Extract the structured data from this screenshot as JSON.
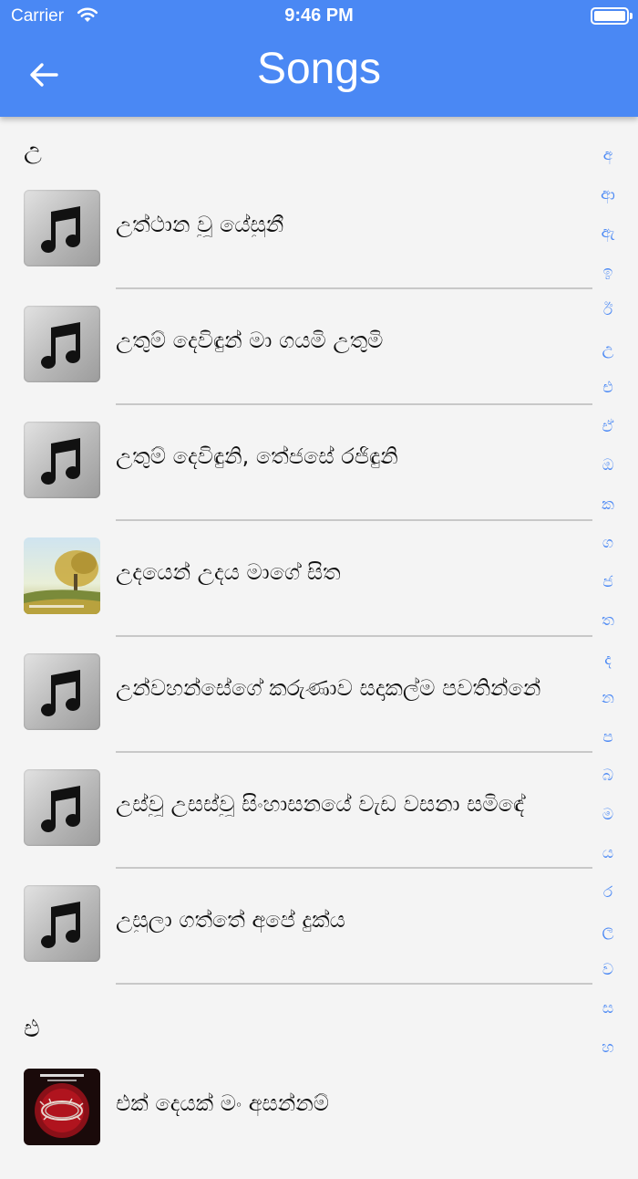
{
  "status_bar": {
    "carrier": "Carrier",
    "time": "9:46 PM"
  },
  "header": {
    "title": "Songs",
    "back_icon": "arrow-left-icon"
  },
  "accent_color": "#4a88f4",
  "sections": [
    {
      "letter": "උ",
      "songs": [
        {
          "title": "උත්ථාන වූ යේසුනී",
          "art": "music-note"
        },
        {
          "title": "උතුම් දෙවිඳුන් මා ගයමි උතුමි",
          "art": "music-note"
        },
        {
          "title": "උතුම් දෙවිඳුනි, තේජසේ රජිඳුනි",
          "art": "music-note"
        },
        {
          "title": "උදයෙන් උදය මාගේ සිත",
          "art": "album-landscape"
        },
        {
          "title": "උන්වහන්සේගේ කරුණාව සදාකල්ම පවතින්නේ",
          "art": "music-note"
        },
        {
          "title": "උස්වූ උසස්වූ සිංහාසනයේ වැඩ වසනා සමිඳේ",
          "art": "music-note"
        },
        {
          "title": "උසුලා ගත්තේ අපේ දුක්ය",
          "art": "music-note"
        }
      ]
    },
    {
      "letter": "එ",
      "songs": [
        {
          "title": "එක් දෙයක් මං අසන්නම්",
          "art": "album-crown-of-thorns"
        }
      ]
    }
  ],
  "index_letters": [
    "අ",
    "ආ",
    "ඇ",
    "ඉ",
    "ඊ",
    "උ",
    "එ",
    "ඒ",
    "ඔ",
    "ක",
    "ග",
    "ජ",
    "ත",
    "ද",
    "න",
    "ප",
    "බ",
    "ම",
    "ය",
    "ර",
    "ල",
    "ව",
    "ස",
    "හ"
  ]
}
